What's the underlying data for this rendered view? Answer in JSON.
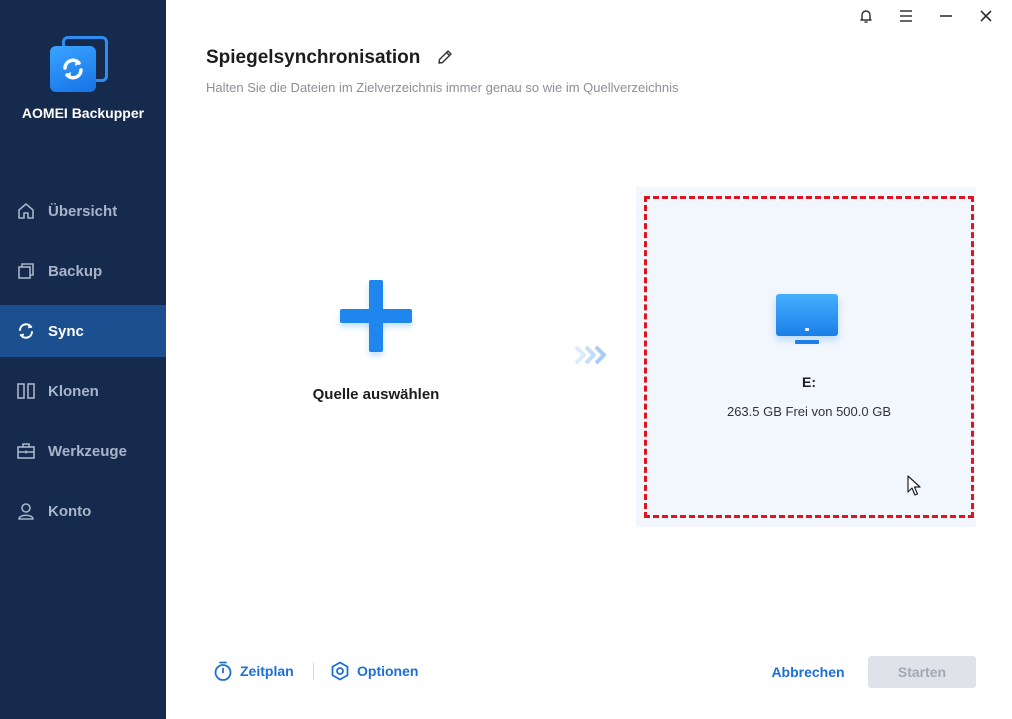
{
  "app": {
    "name": "AOMEI Backupper"
  },
  "sidebar": {
    "items": [
      {
        "label": "Übersicht",
        "icon": "home-icon"
      },
      {
        "label": "Backup",
        "icon": "backup-icon"
      },
      {
        "label": "Sync",
        "icon": "sync-icon",
        "active": true
      },
      {
        "label": "Klonen",
        "icon": "clone-icon"
      },
      {
        "label": "Werkzeuge",
        "icon": "toolbox-icon"
      },
      {
        "label": "Konto",
        "icon": "user-icon"
      }
    ]
  },
  "window_controls": [
    "bell-icon",
    "menu-icon",
    "minimize-icon",
    "close-icon"
  ],
  "header": {
    "title": "Spiegelsynchronisation",
    "subtitle": "Halten Sie die Dateien im Zielverzeichnis immer genau so wie im Quellverzeichnis"
  },
  "source": {
    "label": "Quelle auswählen"
  },
  "destination": {
    "drive": "E:",
    "space": "263.5 GB Frei von 500.0 GB"
  },
  "footer": {
    "schedule_label": "Zeitplan",
    "options_label": "Optionen",
    "cancel_label": "Abbrechen",
    "start_label": "Starten"
  },
  "colors": {
    "sidebar_bg": "#162a4d",
    "active_item": "#1b4f8f",
    "accent": "#1f86ee",
    "dashed_border": "#e0141e"
  }
}
